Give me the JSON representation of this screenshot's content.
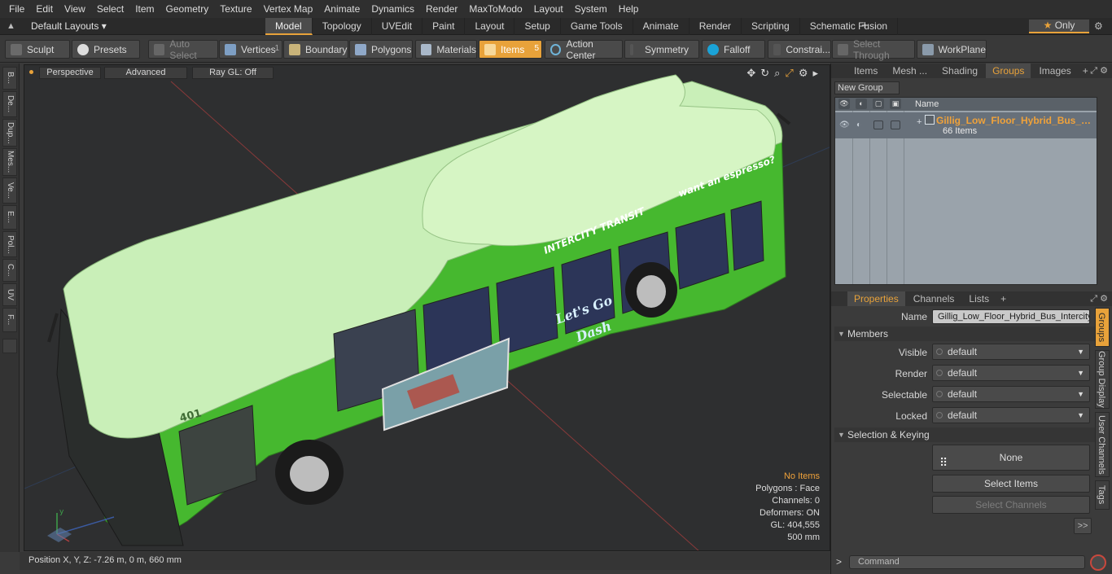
{
  "menu": [
    "File",
    "Edit",
    "View",
    "Select",
    "Item",
    "Geometry",
    "Texture",
    "Vertex Map",
    "Animate",
    "Dynamics",
    "Render",
    "MaxToModo",
    "Layout",
    "System",
    "Help"
  ],
  "layoutbar": {
    "layouts_label": "Default Layouts ▾",
    "tabs": [
      "Model",
      "Topology",
      "UVEdit",
      "Paint",
      "Layout",
      "Setup",
      "Game Tools",
      "Animate",
      "Render",
      "Scripting",
      "Schematic Fusion"
    ],
    "active_tab": "Model",
    "only_label": "Only"
  },
  "toolbar": {
    "sculpt": "Sculpt",
    "presets": "Presets",
    "auto_select": "Auto Select",
    "vertices": "Vertices",
    "vertices_count": "1",
    "boundary": "Boundary",
    "polygons": "Polygons",
    "materials": "Materials",
    "items": "Items",
    "items_count": "5",
    "action_center": "Action Center",
    "symmetry": "Symmetry",
    "falloff": "Falloff",
    "constraints": "Constrai...",
    "select_through": "Select Through",
    "workplane": "WorkPlane"
  },
  "left_strip": [
    "B...",
    "De...",
    "Dup...",
    "Mes...",
    "Ve...",
    "E...",
    "Pol...",
    "C...",
    "UV",
    "F..."
  ],
  "viewport": {
    "perspective": "Perspective",
    "advanced": "Advanced",
    "raygl": "Ray GL: Off",
    "bus_number": "401",
    "brand_text": "INTERCITY TRANSIT",
    "slogan1": "Let's Go",
    "slogan2": "Dash",
    "slogan_top": "want an espresso?",
    "overlay": {
      "no_items": "No Items",
      "polygons": "Polygons : Face",
      "channels": "Channels: 0",
      "deformers": "Deformers: ON",
      "gl": "GL: 404,555",
      "scale": "500 mm"
    }
  },
  "status": {
    "position": "Position X, Y, Z:   -7.26 m, 0 m, 660 mm"
  },
  "groups_panel": {
    "tabs": [
      "Items",
      "Mesh ...",
      "Shading",
      "Groups",
      "Images"
    ],
    "active_tab": "Groups",
    "new_group": "New Group",
    "col_name": "Name",
    "group_name": "Gillig_Low_Floor_Hybrid_Bus_In...",
    "group_count": "66 Items"
  },
  "properties_panel": {
    "tabs": [
      "Properties",
      "Channels",
      "Lists"
    ],
    "active_tab": "Properties",
    "name_label": "Name",
    "name_value": "Gillig_Low_Floor_Hybrid_Bus_Intercity",
    "members": "Members",
    "visible_label": "Visible",
    "visible": "default",
    "render_label": "Render",
    "render": "default",
    "selectable_label": "Selectable",
    "selectable": "default",
    "locked_label": "Locked",
    "locked": "default",
    "selection_keying": "Selection & Keying",
    "none": "None",
    "select_items": "Select Items",
    "select_channels": "Select Channels",
    "more": ">>",
    "vtabs": [
      "Groups",
      "Group Display",
      "User Channels",
      "Tags"
    ]
  },
  "command": {
    "prompt": ">",
    "placeholder": "Command"
  },
  "colors": {
    "accent": "#e8a23a",
    "bus_green": "#46b82f",
    "roof": "#c9efb8"
  }
}
